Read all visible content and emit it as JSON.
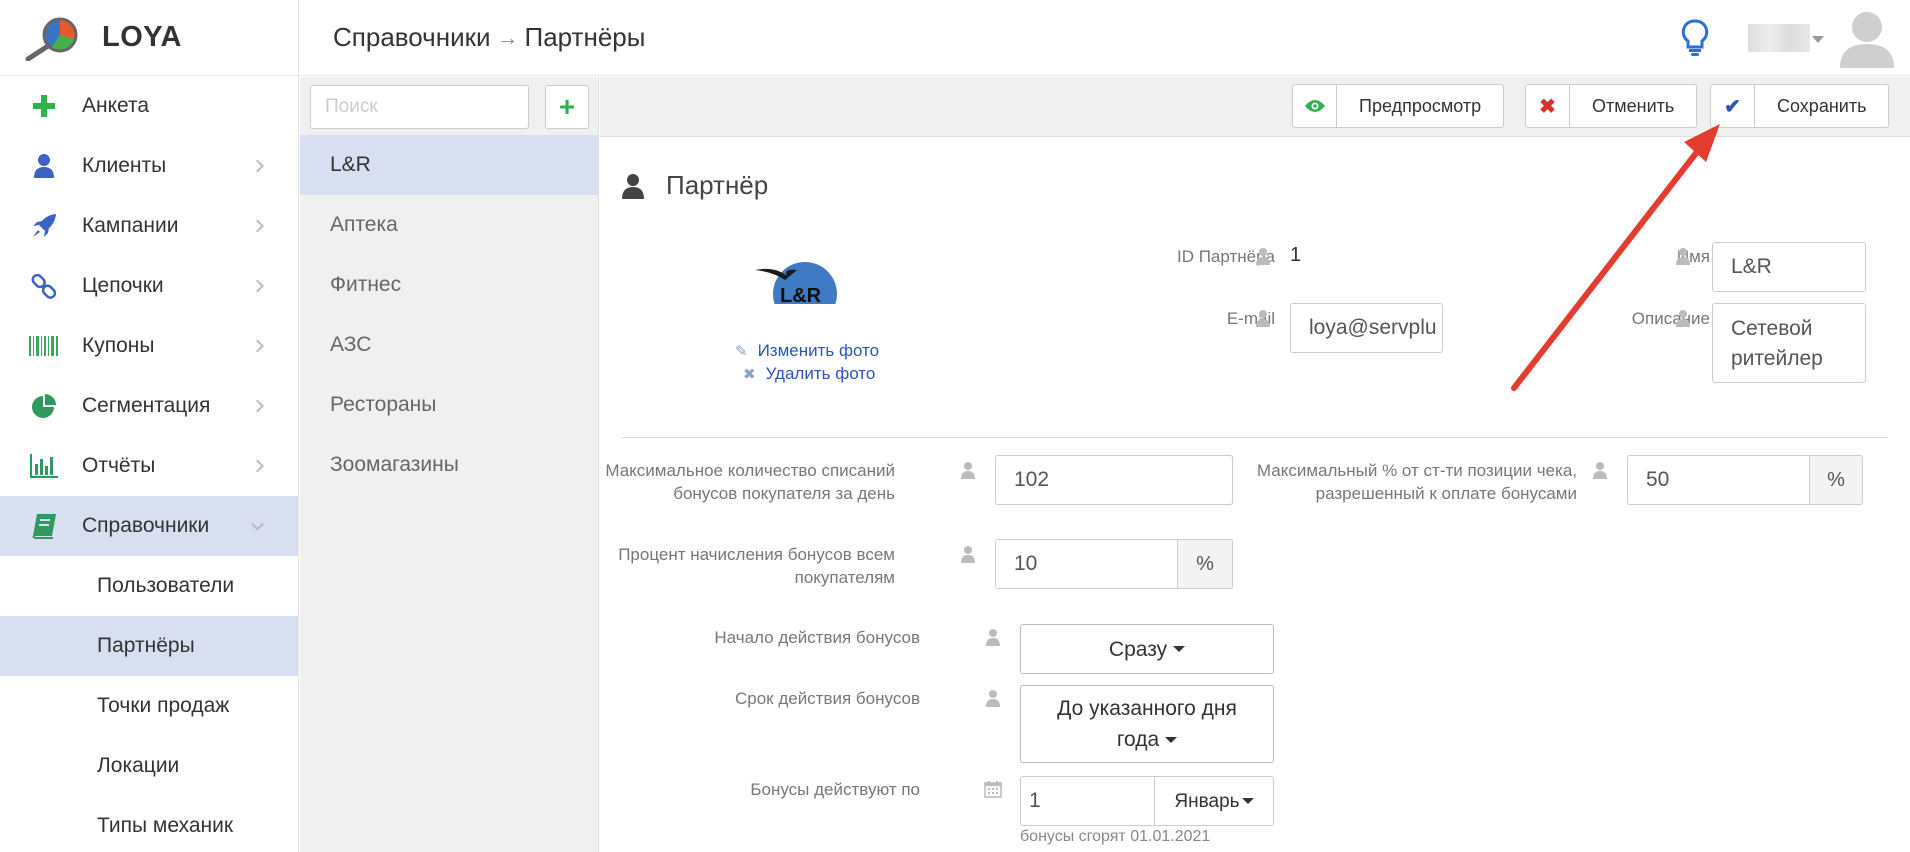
{
  "app": {
    "name": "LOYA"
  },
  "sidebar": {
    "items": [
      {
        "label": "Анкета",
        "icon": "plus-icon"
      },
      {
        "label": "Клиенты",
        "icon": "user-icon"
      },
      {
        "label": "Кампании",
        "icon": "rocket-icon"
      },
      {
        "label": "Цепочки",
        "icon": "chain-link-icon"
      },
      {
        "label": "Купоны",
        "icon": "barcode-icon"
      },
      {
        "label": "Сегментация",
        "icon": "pie-chart-icon"
      },
      {
        "label": "Отчёты",
        "icon": "bar-chart-icon"
      },
      {
        "label": "Справочники",
        "icon": "book-icon"
      }
    ],
    "subitems": [
      {
        "label": "Пользователи"
      },
      {
        "label": "Партнёры"
      },
      {
        "label": "Точки продаж"
      },
      {
        "label": "Локации"
      },
      {
        "label": "Типы механик"
      }
    ]
  },
  "header": {
    "breadcrumb_parent": "Справочники",
    "breadcrumb_separator": "→",
    "breadcrumb_current": "Партнёры"
  },
  "partner_list": {
    "search_placeholder": "Поиск",
    "add_label": "+",
    "items": [
      "L&R",
      "Аптека",
      "Фитнес",
      "АЗС",
      "Рестораны",
      "Зоомагазины"
    ]
  },
  "toolbar": {
    "preview_label": "Предпросмотр",
    "cancel_label": "Отменить",
    "save_label": "Сохранить"
  },
  "form": {
    "section_title": "Партнёр",
    "change_photo": "Изменить фото",
    "delete_photo": "Удалить фото",
    "id_label": "ID Партнёра",
    "id_value": "1",
    "email_label": "E-mail",
    "email_value": "loya@servplu",
    "name_label": "Имя",
    "name_value": "L&R",
    "description_label": "Описание",
    "description_line1": "Сетевой",
    "description_line2": "ритейлер",
    "max_writeoffs_label_1": "Максимальное количество списаний",
    "max_writeoffs_label_2": "бонусов покупателя за день",
    "max_writeoffs_value": "102",
    "max_percent_label_1": "Максимальный % от ст-ти позиции чека,",
    "max_percent_label_2": "разрешенный к оплате бонусами",
    "max_percent_value": "50",
    "percent_sign": "%",
    "accrual_label_1": "Процент начисления бонусов всем",
    "accrual_label_2": "покупателям",
    "accrual_value": "10",
    "start_label": "Начало действия бонусов",
    "start_value": "Сразу",
    "validity_label": "Срок действия бонусов",
    "validity_line1": "До указанного дня",
    "validity_line2": "года",
    "valid_until_label": "Бонусы действуют по",
    "valid_until_day": "1",
    "valid_until_month": "Январь",
    "expiry_hint": "бонусы сгорят 01.01.2021"
  },
  "colors": {
    "accent": "#2b55b8",
    "active_bg": "#d7dff0",
    "green": "#2db34a",
    "red": "#d9302c"
  }
}
